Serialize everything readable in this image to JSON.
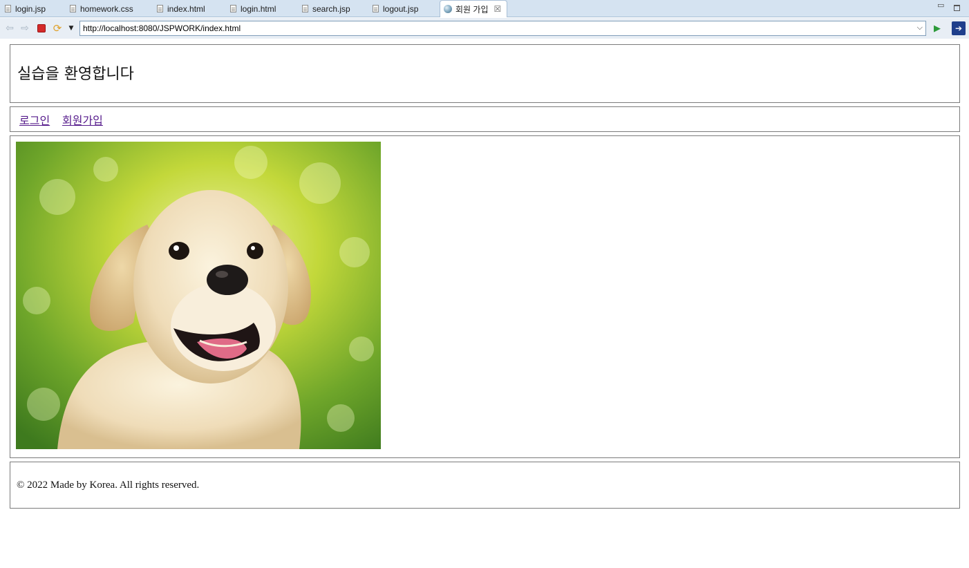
{
  "editor_tabs": [
    {
      "label": "login.jsp"
    },
    {
      "label": "homework.css"
    },
    {
      "label": "index.html"
    },
    {
      "label": "login.html"
    },
    {
      "label": "search.jsp"
    },
    {
      "label": "logout.jsp"
    }
  ],
  "active_tab": {
    "label": "회원 가입",
    "icon": "globe-icon",
    "close_glyph": "☒"
  },
  "window_controls": {
    "minimize_glyph": "▭"
  },
  "browser": {
    "url": "http://localhost:8080/JSPWORK/index.html",
    "icons": [
      "back-arrow-icon",
      "forward-arrow-icon",
      "stop-icon",
      "refresh-icon",
      "dropdown-icon",
      "go-icon",
      "eclipse-icon"
    ]
  },
  "page": {
    "title": "실습을 환영합니다",
    "nav": {
      "login": "로그인",
      "join": "회원가입"
    },
    "image": {
      "subject": "puppy"
    },
    "footer": "© 2022 Made by Korea. All rights reserved."
  },
  "colors": {
    "visited_link": "#551a8b",
    "tab_bar": "#d5e3f1",
    "border": "#7a7a7a"
  }
}
